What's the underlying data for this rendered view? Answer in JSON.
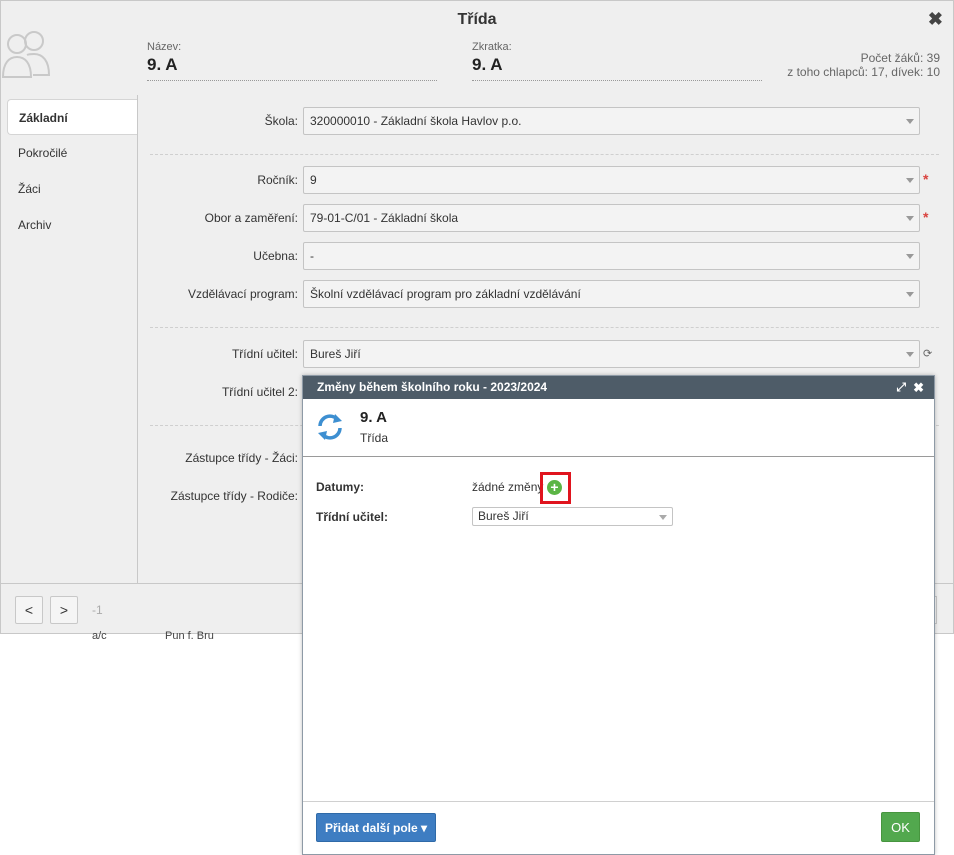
{
  "dialog": {
    "title": "Třída",
    "close_glyph": "✖",
    "header": {
      "name_label": "Název:",
      "name_value": "9. A",
      "abbr_label": "Zkratka:",
      "abbr_value": "9. A",
      "stats_line1": "Počet žáků: 39",
      "stats_line2": "z toho chlapců: 17, dívek: 10"
    },
    "sidebar": {
      "items": [
        {
          "label": "Základní"
        },
        {
          "label": "Pokročilé"
        },
        {
          "label": "Žáci"
        },
        {
          "label": "Archiv"
        }
      ]
    },
    "form": {
      "school_label": "Škola:",
      "school_value": "320000010 - Základní škola Havlov p.o.",
      "grade_label": "Ročník:",
      "grade_value": "9",
      "field_label": "Obor a zaměření:",
      "field_value": "79-01-C/01 - Základní škola",
      "room_label": "Učebna:",
      "room_value": "-",
      "program_label": "Vzdělávací program:",
      "program_value": "Školní vzdělávací program pro základní vzdělávání",
      "teacher_label": "Třídní učitel:",
      "teacher_value": "Bureš Jiří",
      "teacher2_label": "Třídní učitel 2:",
      "rep_students_label": "Zástupce třídy - Žáci:",
      "rep_parents_label": "Zástupce třídy - Rodiče:",
      "required_mark": "*",
      "refresh_glyph": "⟳"
    },
    "footer": {
      "prev_label": "<",
      "next_label": ">",
      "page_number": "-1"
    }
  },
  "under_text": {
    "left": "a/c",
    "middle": "Pun f. Bru"
  },
  "popup": {
    "title": "Změny během školního roku - 2023/2024",
    "maximize_glyph": "⤢",
    "close_glyph": "✖",
    "class_name": "9. A",
    "class_sub": "Třída",
    "dates_label": "Datumy:",
    "dates_value": "žádné změny",
    "add_glyph": "+",
    "teacher_label": "Třídní učitel:",
    "teacher_value": "Bureš Jiří",
    "add_field_button": "Přidat další pole ▾",
    "ok_button": "OK"
  },
  "colors": {
    "popup_titlebar": "#4e5c68",
    "primary_button": "#3e7dc2",
    "ok_button": "#52a84e",
    "add_icon": "#5bb545",
    "highlight": "#e0141e",
    "required": "#d9433f"
  }
}
